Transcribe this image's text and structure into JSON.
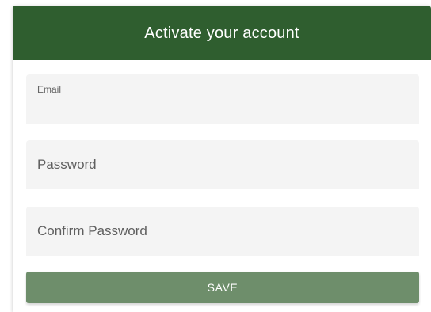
{
  "header": {
    "title": "Activate your account"
  },
  "form": {
    "email": {
      "label": "Email",
      "value": ""
    },
    "password": {
      "placeholder": "Password",
      "value": ""
    },
    "confirm_password": {
      "placeholder": "Confirm Password",
      "value": ""
    },
    "save_label": "SAVE"
  },
  "colors": {
    "header_background": "#2f5e2f",
    "button_background": "#6e8e6b",
    "field_background": "#f4f4f4"
  }
}
